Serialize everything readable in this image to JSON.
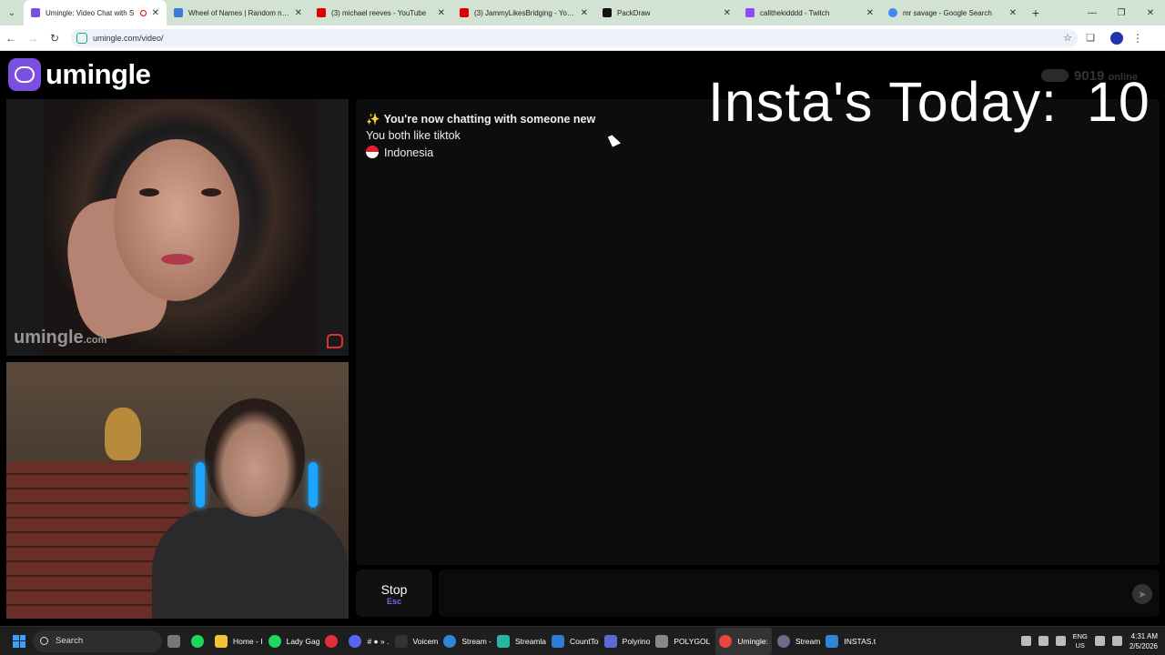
{
  "browser": {
    "tabs": [
      {
        "title": "Umingle: Video Chat with S",
        "active": true,
        "color": "#7b4fe0"
      },
      {
        "title": "Wheel of Names | Random nam",
        "active": false,
        "color": "#3b7bd8"
      },
      {
        "title": "(3) michael reeves - YouTube",
        "active": false,
        "color": "#e00000"
      },
      {
        "title": "(3) JammyLikesBridging - YouT",
        "active": false,
        "color": "#e00000"
      },
      {
        "title": "PackDraw",
        "active": false,
        "color": "#111111"
      },
      {
        "title": "calithekidddd - Twitch",
        "active": false,
        "color": "#9146ff"
      },
      {
        "title": "mr savage - Google Search",
        "active": false,
        "color": "#4285f4"
      }
    ],
    "url": "umingle.com/video/"
  },
  "page": {
    "logo_text": "umingle",
    "watermark_main": "umingle",
    "watermark_suffix": ".com",
    "overlay": {
      "label": "Insta's Today:",
      "count": "10"
    },
    "ghost_counter": "9019",
    "ghost_suffix": "online",
    "messages": {
      "now_chatting": "You're now chatting with someone new",
      "common_interest": "You both like tiktok",
      "country": "Indonesia"
    },
    "stop_button": {
      "label": "Stop",
      "key": "Esc"
    },
    "accent_color": "#7b4fe0"
  },
  "taskbar": {
    "search_label": "Search",
    "apps": [
      {
        "label": "",
        "color": "#3aa0ff"
      },
      {
        "label": "",
        "color": "#777777"
      },
      {
        "label": "",
        "color": "#1ed760"
      },
      {
        "label": "Home - I",
        "color": "#f3c237"
      },
      {
        "label": "Lady Gag",
        "color": "#1ed760"
      },
      {
        "label": "",
        "color": "#e0303a"
      },
      {
        "label": "# ● » .",
        "color": "#5865f2"
      },
      {
        "label": "Voicem",
        "color": "#333333"
      },
      {
        "label": "Stream -",
        "color": "#2f86d6"
      },
      {
        "label": "Streamla",
        "color": "#2bb3a4"
      },
      {
        "label": "CountTo",
        "color": "#2f7bd6"
      },
      {
        "label": "Polyrino",
        "color": "#5a6bd8"
      },
      {
        "label": "POLYGOL",
        "color": "#888888"
      },
      {
        "label": "Umingle:",
        "color": "#e8453c"
      },
      {
        "label": "Stream",
        "color": "#6b6b8a"
      },
      {
        "label": "INSTAS.t",
        "color": "#2f86d6"
      }
    ],
    "lang_top": "ENG",
    "lang_bottom": "US",
    "time": "4:31 AM",
    "date": "2/5/2026"
  }
}
